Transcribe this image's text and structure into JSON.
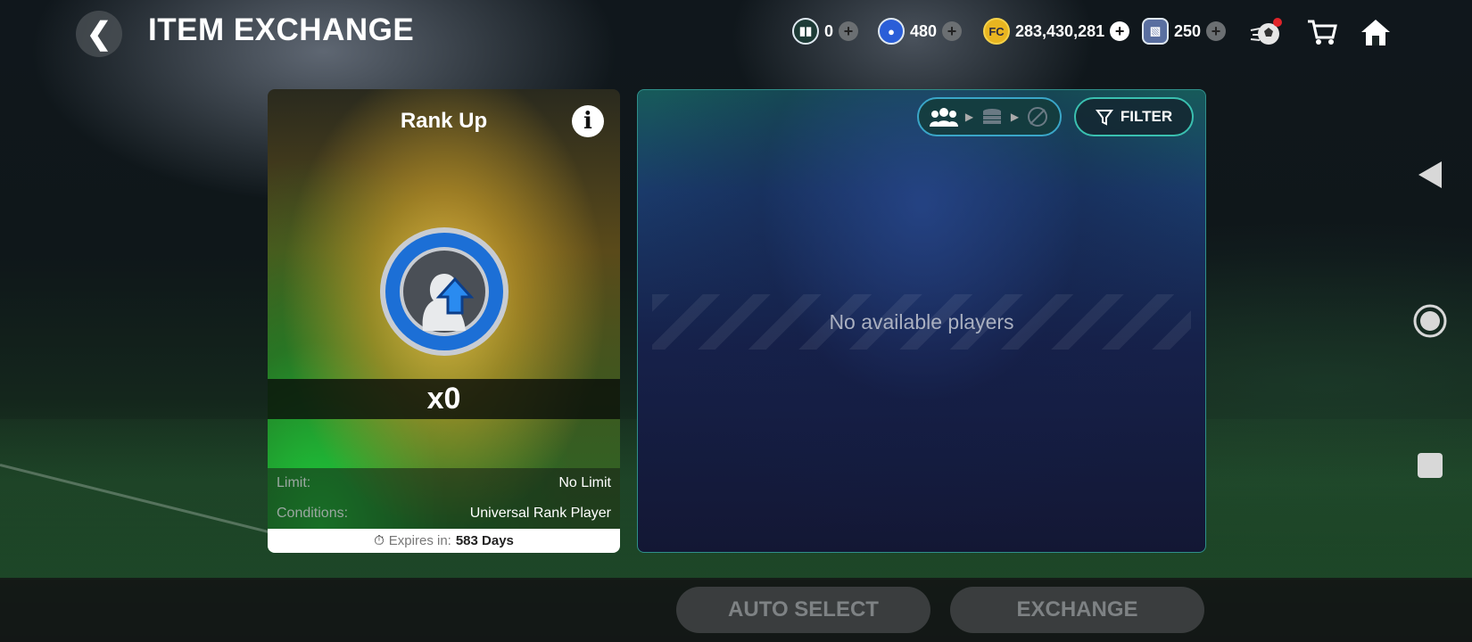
{
  "header": {
    "title": "ITEM EXCHANGE",
    "back_icon": "chevron-left-icon",
    "currencies": [
      {
        "name": "shield-token",
        "value": "0"
      },
      {
        "name": "player-token",
        "value": "480"
      },
      {
        "name": "fc-points",
        "value": "283,430,281"
      },
      {
        "name": "card-token",
        "value": "250"
      }
    ],
    "icons": [
      "ball-notification-icon",
      "cart-icon",
      "home-icon"
    ]
  },
  "card": {
    "title": "Rank Up",
    "count": "x0",
    "limit_label": "Limit:",
    "limit_value": "No Limit",
    "conditions_label": "Conditions:",
    "conditions_value": "Universal Rank Player",
    "expires_label": "Expires in:",
    "expires_value": "583 Days"
  },
  "panel": {
    "filter_label": "FILTER",
    "empty_text": "No available players"
  },
  "actions": {
    "auto_select": "AUTO SELECT",
    "exchange": "EXCHANGE"
  },
  "colors": {
    "accent_teal": "#3ac0b0",
    "disabled_button": "#3a3d3e",
    "notification_dot": "#e0242a"
  }
}
